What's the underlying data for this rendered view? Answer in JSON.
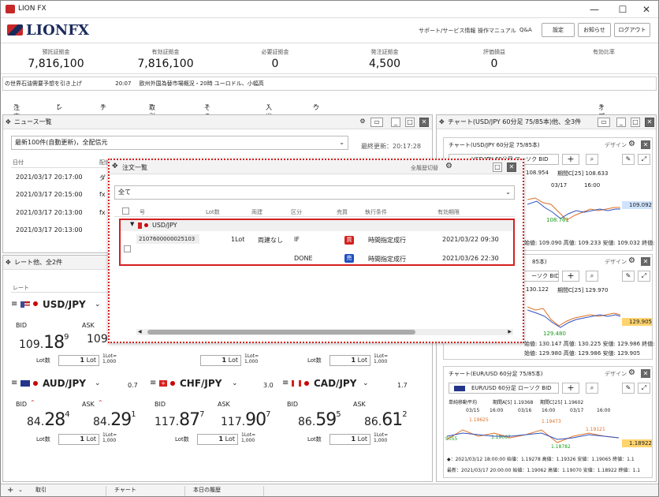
{
  "app": {
    "title": "LION FX",
    "logo": "LIONFX"
  },
  "header_links": [
    "サポート/サービス情報",
    "操作マニュアル",
    "Q&A"
  ],
  "header_buttons": [
    "設定",
    "お知らせ",
    "ログアウト"
  ],
  "summary": [
    {
      "label": "預託証拠金",
      "value": "7,816,100"
    },
    {
      "label": "有効証拠金",
      "value": "7,816,100"
    },
    {
      "label": "必要証拠金",
      "value": "0"
    },
    {
      "label": "発注証拠金",
      "value": "4,500"
    },
    {
      "label": "評価損益",
      "value": "0"
    },
    {
      "label": "有効比率",
      "value": ""
    }
  ],
  "ticker": {
    "text1": "の世界石油需要予想を引き上げ",
    "time": "20:07",
    "text2": "欧州外国為替市場概況・20時 ユーロドル、小幅高"
  },
  "menu": [
    "注文",
    "レート",
    "チャート",
    "取引情報",
    "その他情報",
    "入出金",
    "ウィンドウ"
  ],
  "menu_right": "オプション取引",
  "news": {
    "title": "ニュース一覧",
    "filter": "最新100件(自動更新)，全配信元",
    "last_update": "最終更新：20:17:28",
    "col_date": "日付",
    "col_src": "配信",
    "rows": [
      {
        "date": "2021/03/17 20:17:00",
        "src": "ダ"
      },
      {
        "date": "2021/03/17 20:15:00",
        "src": "fx"
      },
      {
        "date": "2021/03/17 20:13:00",
        "src": "fx"
      },
      {
        "date": "2021/03/17 20:13:00",
        "src": ""
      }
    ]
  },
  "rate": {
    "title": "レート他、全2件",
    "col": "レート",
    "lot_label": "Lot数",
    "lot_unit": "Lot",
    "lot_eq_a": "1Lot=",
    "lot_eq_b": "1,000",
    "pairs": [
      {
        "name": "USD/JPY",
        "bid_label": "BID",
        "ask_label": "ASK",
        "bid_a": "109.",
        "bid_b": "18",
        "bid_c": "9",
        "ask_a": "109.",
        "lot": "1"
      },
      {
        "name": "AUD/JPY",
        "spread": "0.7",
        "bid_label": "BID",
        "ask_label": "ASK",
        "bid_a": "84.",
        "bid_b": "28",
        "bid_c": "4",
        "ask_a": "84.",
        "ask_b": "29",
        "ask_c": "1",
        "lot": "1"
      },
      {
        "name": "CHF/JPY",
        "spread": "3.0",
        "bid_label": "BID",
        "ask_label": "ASK",
        "bid_a": "117.",
        "bid_b": "87",
        "bid_c": "7",
        "ask_a": "117.",
        "ask_b": "90",
        "ask_c": "7",
        "lot": "1"
      },
      {
        "name": "CAD/JPY",
        "spread": "1.7",
        "bid_label": "BID",
        "ask_label": "ASK",
        "bid_a": "86.",
        "bid_b": "59",
        "bid_c": "5",
        "ask_a": "86.",
        "ask_b": "61",
        "ask_c": "2",
        "lot": "1"
      }
    ]
  },
  "charts": {
    "title": "チャート(USD/JPY 60分足 75/85本)他、全3件",
    "design": "デザイン",
    "c1": {
      "title": "チャート(USD/JPY 60分足 75/85本)",
      "pair": "USD/JPY 60分足 ローソク BID",
      "ma": "108.954",
      "ma2": "期間C[25] 108.633",
      "t1": "03/17",
      "t2": "16:00",
      "price": "109.092",
      "low": "108.761",
      "foot": "始値: 109.090 高値: 109.233 安値: 109.032 終値: 109.1"
    },
    "c2": {
      "title": "85本)",
      "pair": "ーソク BID",
      "v1": "130.122",
      "v2": "期間C[25] 129.970",
      "price": "129.905",
      "low": "129.480",
      "foot1": "始値: 130.147 高値: 130.225 安値: 129.986 終値: 129.9",
      "foot2": "始値: 129.980 高値: 129.986 安値: 129.905"
    },
    "c3": {
      "title": "チャート(EUR/USD 60分足 75/85本)",
      "pair": "EUR/USD 60分足 ローソク BID",
      "ma_label": "単純移動平均",
      "ma1": "期間A[5] 1.19368",
      "ma2": "期間C[25] 1.19602",
      "t1": "03/15",
      "t2": "16:00",
      "t3": "03/16",
      "t4": "16:00",
      "t5": "03/17",
      "t6": "16:00",
      "p1": "1.19625",
      "p2": "1.19473",
      "p3": "1.19121",
      "p4": "1.19067",
      "p5": "1.18782",
      "price": "1.18922",
      "left": "9055",
      "foot1": "◆：2021/03/12 18:00:00 始値：1.19278 高値：1.19326 安値：1.19065 終値：1.1",
      "foot2": "最新：2021/03/17 20:00:00 始値：1.19062 高値：1.19070 安値：1.18922 終値：1.1"
    }
  },
  "orders": {
    "title": "注文一覧",
    "batch": "全履歴切替",
    "filter": "全て",
    "cols": [
      "号",
      "Lot数",
      "両建",
      "区分",
      "売買",
      "執行条件",
      "有効期限"
    ],
    "group": "USD/JPY",
    "row": {
      "id": "2107600000025103",
      "lot": "1Lot",
      "hedge": "両建なし",
      "type1": "IF",
      "side1": "買",
      "cond1": "時間指定成行",
      "exp1": "2021/03/22 09:30",
      "type2": "DONE",
      "side2": "売",
      "cond2": "時間指定成行",
      "exp2": "2021/03/26 22:30"
    }
  },
  "tabs": [
    "取引",
    "チャート",
    "本日の履歴"
  ],
  "colors": {
    "buy": "#d42020",
    "sell": "#2050c0",
    "highlight": "#d42020",
    "brand": "#1a2a5c"
  }
}
